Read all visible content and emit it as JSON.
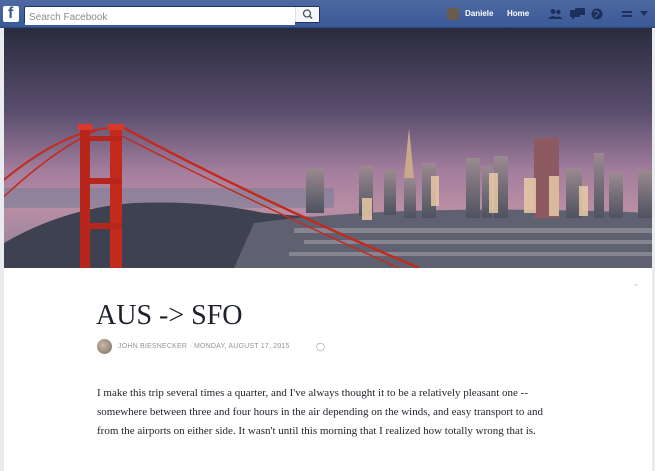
{
  "topbar": {
    "logo_letter": "f",
    "search_placeholder": "Search Facebook",
    "user_name": "Daniele",
    "home_label": "Home",
    "icons": [
      "search-icon",
      "friend-requests-icon",
      "messages-icon",
      "notifications-icon",
      "privacy-icon",
      "account-menu-icon"
    ]
  },
  "note": {
    "cover_image": "golden-gate-bridge-san-francisco-skyline",
    "title": "AUS -> SFO",
    "author": "JOHN BIESNECKER",
    "separator": "·",
    "date": "MONDAY, AUGUST 17, 2015",
    "body": "I make this trip several times a quarter, and I've always thought it to be a relatively pleasant one -- somewhere between three and four hours in the air depending on the winds, and easy transport to and from the airports on either side. It wasn't until this morning that I realized how totally wrong that is."
  },
  "colors": {
    "brand": "#3b5998",
    "bridge": "#c42a1c",
    "text": "#1d2129",
    "meta": "#90949c"
  }
}
